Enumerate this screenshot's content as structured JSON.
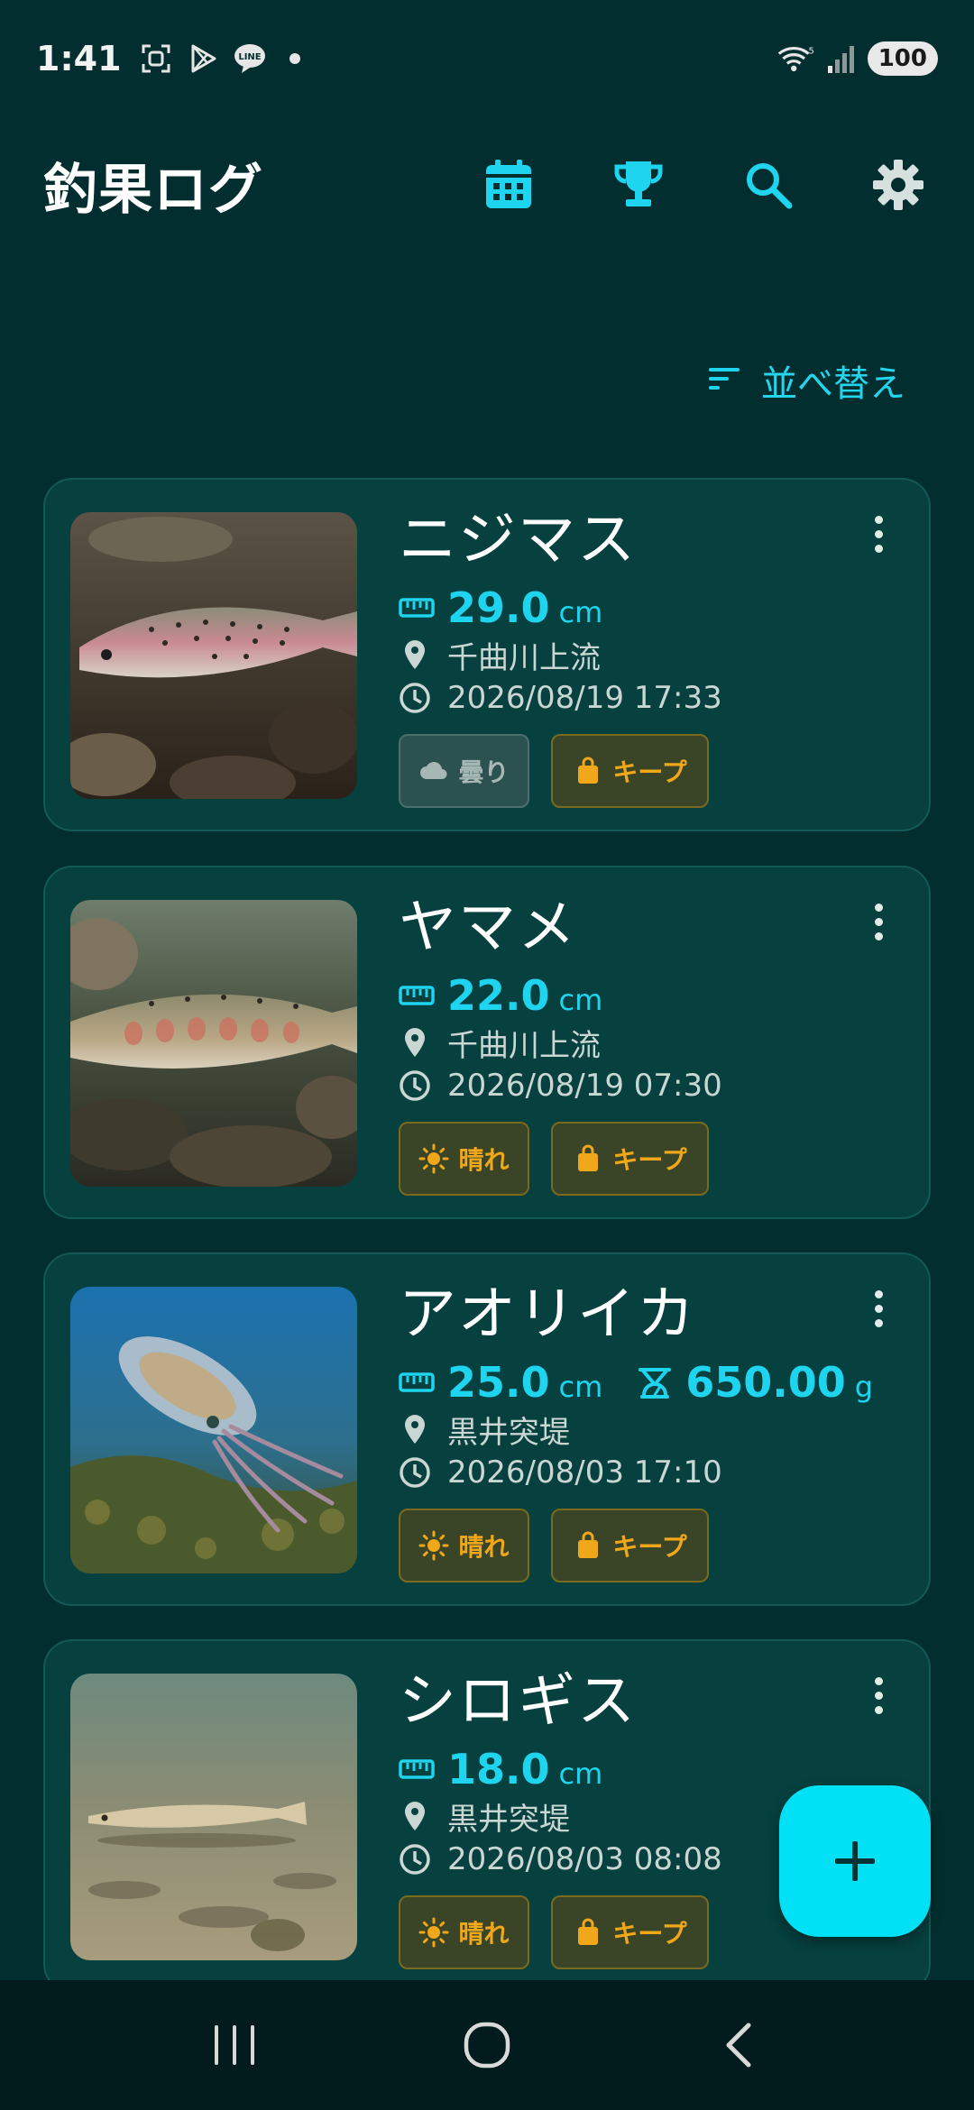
{
  "status_bar": {
    "time": "1:41",
    "battery": "100",
    "left_icons": [
      "screenshot-icon",
      "play-store-icon",
      "line-icon",
      "dot"
    ],
    "right_icons": [
      "wifi-icon",
      "signal-icon",
      "battery-icon"
    ]
  },
  "app_bar": {
    "title": "釣果ログ",
    "actions": [
      "calendar-icon",
      "trophy-icon",
      "search-icon",
      "gear-icon"
    ]
  },
  "sort": {
    "label": "並べ替え"
  },
  "colors": {
    "background": "#032e2f",
    "card": "#06403f",
    "accent": "#1fd4ee",
    "fab": "#00e1f5",
    "chip_orange": "#f0a81a"
  },
  "catches": [
    {
      "name": "ニジマス",
      "length_value": "29.0",
      "length_unit": "cm",
      "location": "千曲川上流",
      "datetime": "2026/08/19 17:33",
      "weather": "曇り",
      "weather_icon": "cloud-icon",
      "status": "キープ",
      "status_icon": "bag-icon"
    },
    {
      "name": "ヤマメ",
      "length_value": "22.0",
      "length_unit": "cm",
      "location": "千曲川上流",
      "datetime": "2026/08/19 07:30",
      "weather": "晴れ",
      "weather_icon": "sun-icon",
      "status": "キープ",
      "status_icon": "bag-icon"
    },
    {
      "name": "アオリイカ",
      "length_value": "25.0",
      "length_unit": "cm",
      "weight_value": "650.00",
      "weight_unit": "g",
      "location": "黒井突堤",
      "datetime": "2026/08/03 17:10",
      "weather": "晴れ",
      "weather_icon": "sun-icon",
      "status": "キープ",
      "status_icon": "bag-icon"
    },
    {
      "name": "シロギス",
      "length_value": "18.0",
      "length_unit": "cm",
      "location": "黒井突堤",
      "datetime": "2026/08/03 08:08",
      "weather": "晴れ",
      "weather_icon": "sun-icon",
      "status": "キープ",
      "status_icon": "bag-icon"
    }
  ],
  "fab": {
    "icon": "plus-icon"
  },
  "nav_bar": {
    "buttons": [
      "recents-icon",
      "home-icon",
      "back-icon"
    ]
  }
}
